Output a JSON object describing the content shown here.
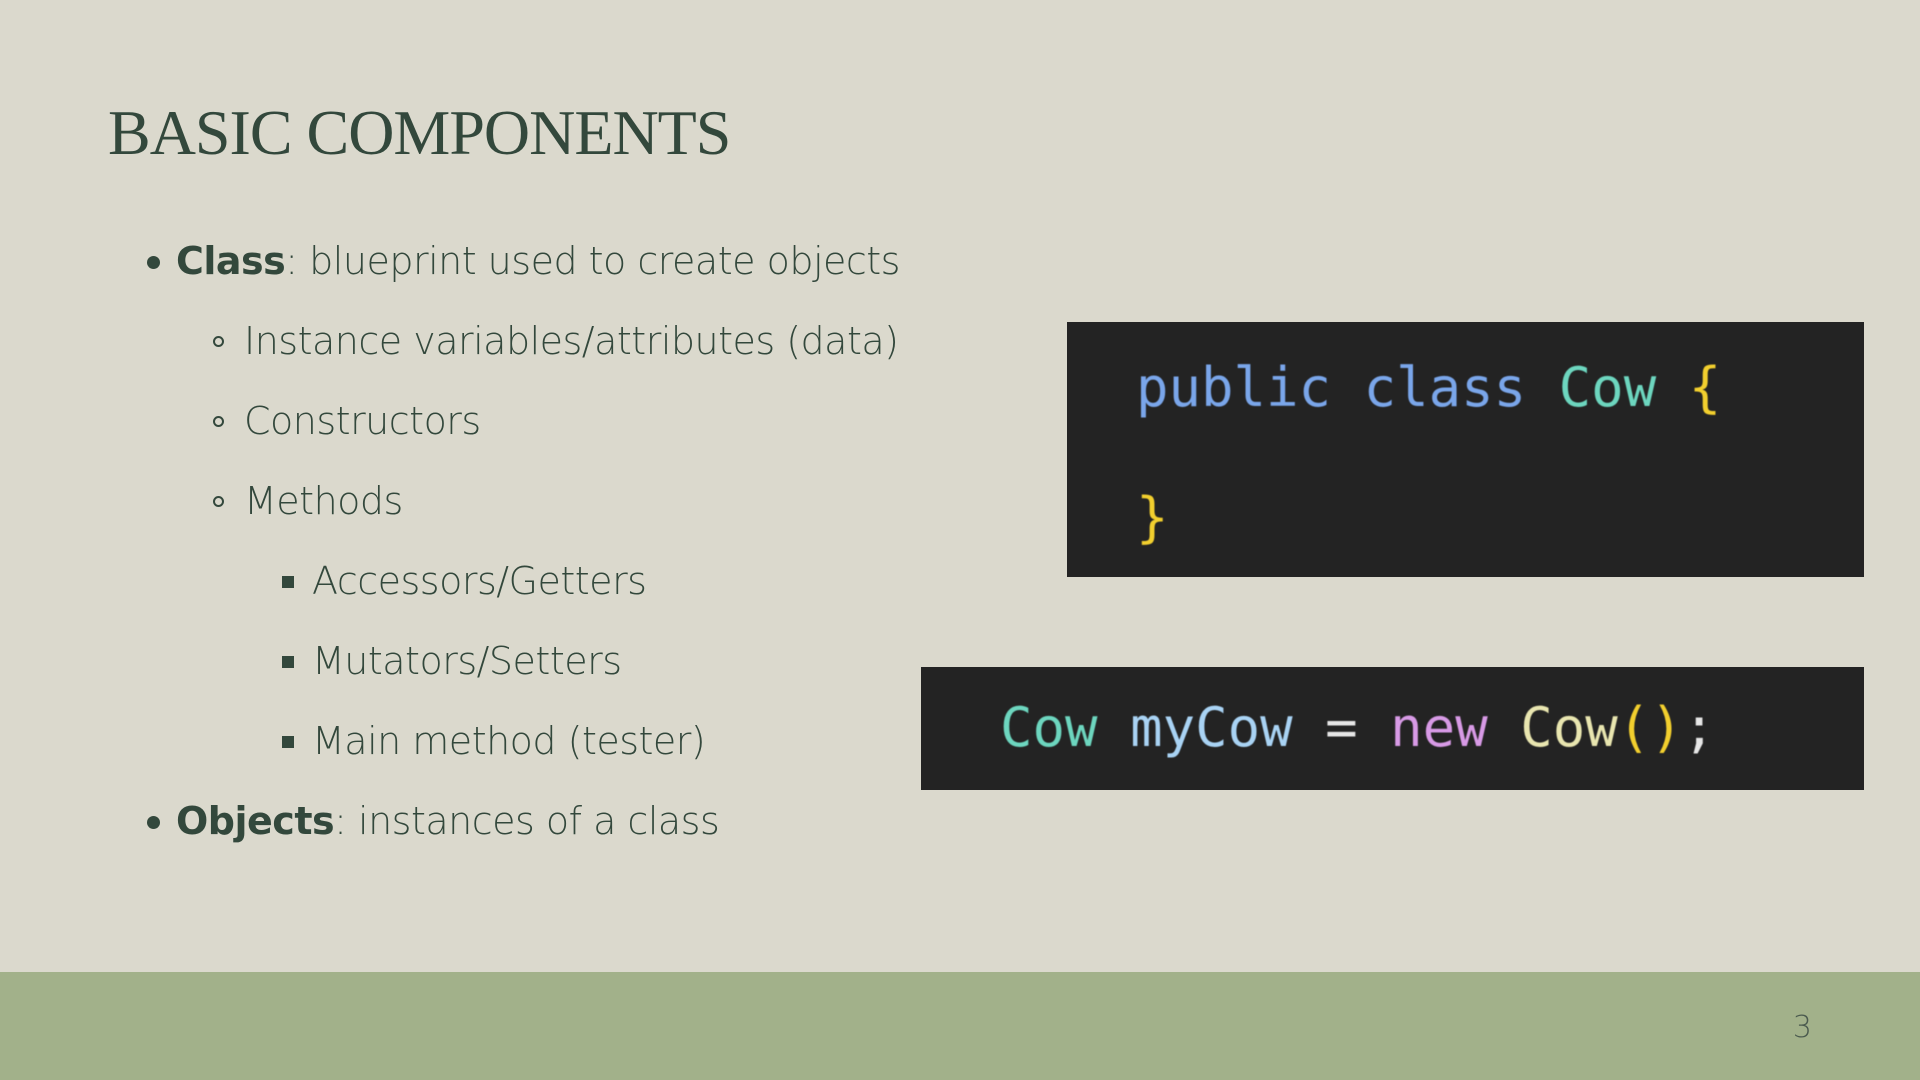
{
  "slide": {
    "title": "BASIC COMPONENTS",
    "page_number": "3"
  },
  "bullets": [
    {
      "level": 1,
      "bold": "Class",
      "text": ": blueprint used to create objects"
    },
    {
      "level": 2,
      "bold": "",
      "text": "Instance variables/attributes (data)"
    },
    {
      "level": 2,
      "bold": "",
      "text": "Constructors"
    },
    {
      "level": 2,
      "bold": "",
      "text": "Methods"
    },
    {
      "level": 3,
      "bold": "",
      "text": "Accessors/Getters"
    },
    {
      "level": 3,
      "bold": "",
      "text": "Mutators/Setters"
    },
    {
      "level": 3,
      "bold": "",
      "text": "Main method (tester)"
    },
    {
      "level": 1,
      "bold": "Objects",
      "text": ": instances of a class"
    }
  ],
  "code_snippets": {
    "class_declaration": {
      "line1": {
        "keyword_public": "public",
        "keyword_class": "class",
        "type_name": "Cow",
        "open_brace": "{"
      },
      "line2": {
        "close_brace": "}"
      }
    },
    "instantiation": {
      "type_name": "Cow",
      "variable": "myCow",
      "operator": "=",
      "keyword_new": "new",
      "constructor_call": "Cow",
      "parens": "()",
      "semicolon": ";"
    }
  },
  "colors": {
    "background": "#dbd9cd",
    "footer": "#a2b18a",
    "text": "#33483c",
    "code_background": "#232323",
    "code_keyword": "#7aa6ea",
    "code_type": "#6dd6bf",
    "code_brace": "#f2cf2e",
    "code_identifier": "#a9d3f4",
    "code_new": "#d89ae6"
  }
}
